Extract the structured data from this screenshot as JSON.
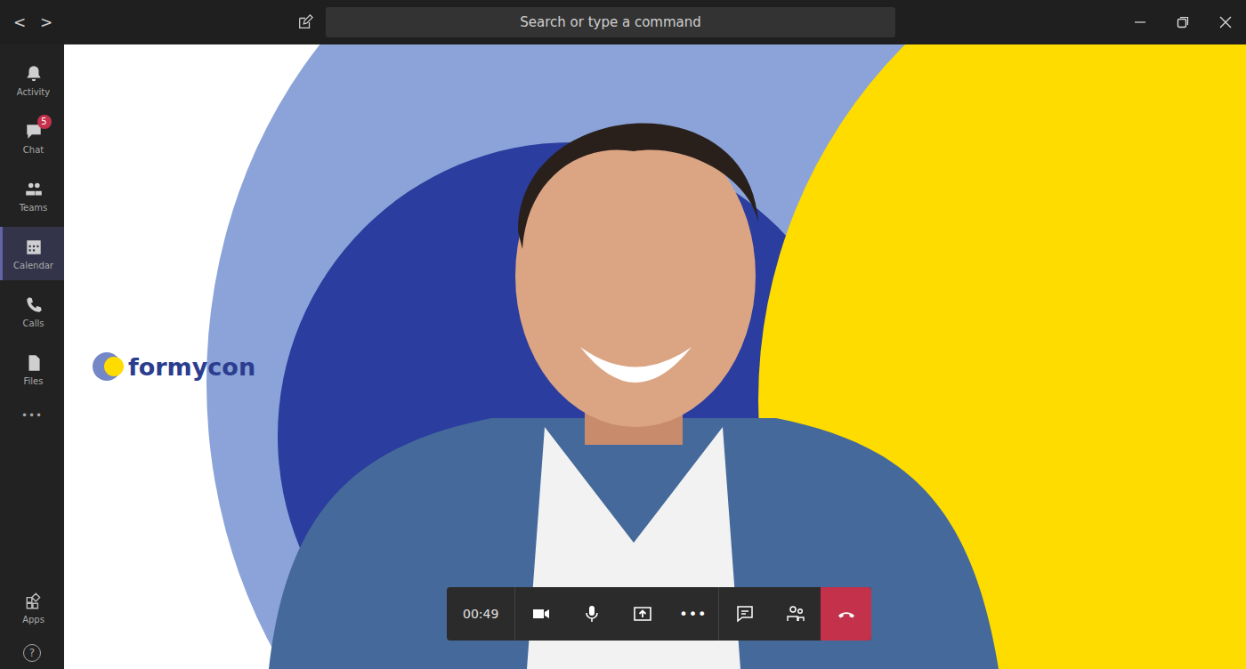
{
  "window": {
    "nav": [
      "<",
      ">"
    ],
    "search": {
      "placeholder": "Search or type a command"
    }
  },
  "sidebar": {
    "items": [
      {
        "label": "Activity",
        "selected": false,
        "badge": ""
      },
      {
        "label": "Chat",
        "selected": false,
        "badge": "5"
      },
      {
        "label": "Teams",
        "selected": false,
        "badge": ""
      },
      {
        "label": "Calendar",
        "selected": true,
        "badge": ""
      },
      {
        "label": "Calls",
        "selected": false,
        "badge": ""
      },
      {
        "label": "Files",
        "selected": false,
        "badge": ""
      }
    ],
    "more": "•••",
    "apps": {
      "label": "Apps"
    },
    "help": "?"
  },
  "stage": {
    "logo": "formycon"
  },
  "call": {
    "time": "00:49",
    "more": "•••"
  }
}
